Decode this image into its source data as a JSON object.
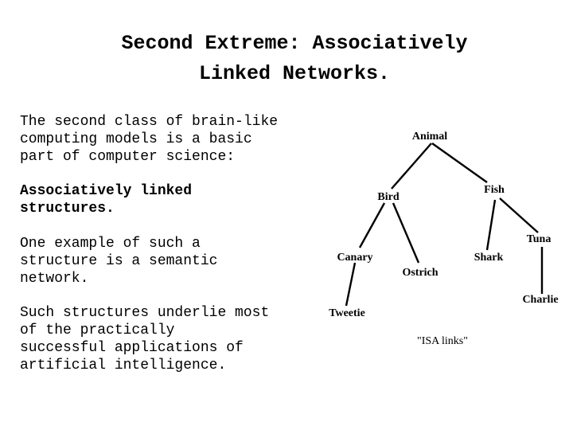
{
  "title": {
    "line1": "Second Extreme: Associatively",
    "line2": "Linked Networks."
  },
  "paragraphs": [
    {
      "bold": false,
      "lines": [
        "The second class of brain-like",
        "computing models is a basic",
        "part of computer science:"
      ]
    },
    {
      "bold": true,
      "lines": [
        "Associatively linked",
        "structures."
      ]
    },
    {
      "bold": false,
      "lines": [
        "One example of such a",
        "structure is a semantic",
        "network."
      ]
    },
    {
      "bold": false,
      "lines": [
        "Such structures underlie most",
        "of the practically",
        "successful applications of",
        "artificial intelligence."
      ]
    }
  ],
  "diagram": {
    "nodes": {
      "animal": "Animal",
      "bird": "Bird",
      "fish": "Fish",
      "canary": "Canary",
      "ostrich": "Ostrich",
      "shark": "Shark",
      "tuna": "Tuna",
      "tweetie": "Tweetie",
      "charlie": "Charlie"
    },
    "edges": [
      [
        "Animal",
        "Bird"
      ],
      [
        "Animal",
        "Fish"
      ],
      [
        "Bird",
        "Canary"
      ],
      [
        "Bird",
        "Ostrich"
      ],
      [
        "Canary",
        "Tweetie"
      ],
      [
        "Fish",
        "Shark"
      ],
      [
        "Fish",
        "Tuna"
      ],
      [
        "Tuna",
        "Charlie"
      ]
    ],
    "caption": "\"ISA links\""
  }
}
